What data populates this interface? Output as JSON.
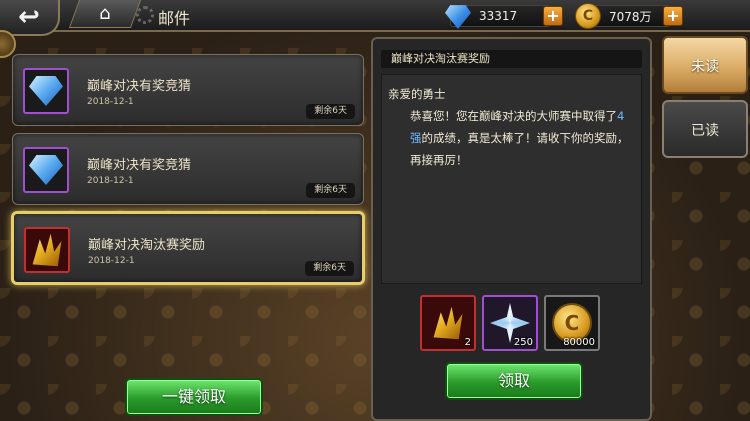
{
  "header": {
    "title": "邮件",
    "back_icon": "back-arrow-icon",
    "home_icon": "home-icon"
  },
  "currency": {
    "diamonds": "33317",
    "gold": "7078万",
    "add_symbol": "+"
  },
  "mail_list": [
    {
      "title": "巅峰对决有奖竞猜",
      "date": "2018-12-1",
      "remaining": "剩余6天",
      "icon": "diamond-icon",
      "selected": false
    },
    {
      "title": "巅峰对决有奖竞猜",
      "date": "2018-12-1",
      "remaining": "剩余6天",
      "icon": "diamond-icon",
      "selected": false
    },
    {
      "title": "巅峰对决淘汰赛奖励",
      "date": "2018-12-1",
      "remaining": "剩余6天",
      "icon": "weapon-icon",
      "selected": true
    }
  ],
  "claim_all_label": "一键领取",
  "detail": {
    "title": "巅峰对决淘汰赛奖励",
    "greeting": "亲爱的勇士",
    "body_part1": "恭喜您！您在巅峰对决的大师赛中取得了",
    "highlight": "4强",
    "body_part2": "的成绩，真是太棒了！请收下你的奖励，再接再厉！",
    "rewards": [
      {
        "icon": "weapon-icon",
        "count": "2"
      },
      {
        "icon": "snowflake-icon",
        "count": "250"
      },
      {
        "icon": "gold-coin-icon",
        "count": "80000"
      }
    ],
    "claim_label": "领取"
  },
  "tabs": {
    "unread": "未读",
    "read": "已读"
  },
  "colors": {
    "highlight_blue": "#6fb8ff",
    "selected_border": "#e6cf6a",
    "button_green": "#2a9a2a",
    "tab_active": "#d8a862"
  }
}
